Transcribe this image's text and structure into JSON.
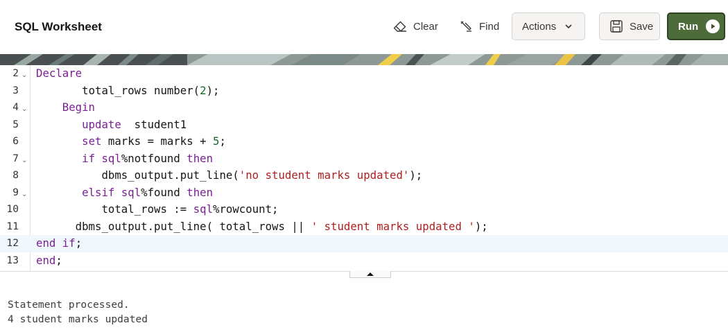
{
  "header": {
    "title": "SQL Worksheet",
    "clear_label": "Clear",
    "find_label": "Find",
    "actions_label": "Actions",
    "save_label": "Save",
    "run_label": "Run"
  },
  "editor": {
    "active_line": "12",
    "lines": [
      {
        "num": "2",
        "foldable": true
      },
      {
        "num": "3",
        "foldable": false
      },
      {
        "num": "4",
        "foldable": true
      },
      {
        "num": "5",
        "foldable": false
      },
      {
        "num": "6",
        "foldable": false
      },
      {
        "num": "7",
        "foldable": true
      },
      {
        "num": "8",
        "foldable": false
      },
      {
        "num": "9",
        "foldable": true
      },
      {
        "num": "10",
        "foldable": false
      },
      {
        "num": "11",
        "foldable": false
      },
      {
        "num": "12",
        "foldable": false
      },
      {
        "num": "13",
        "foldable": false
      }
    ],
    "code": {
      "l2_declare": "Declare",
      "l3_var": "total_rows number(",
      "l3_num": "2",
      "l3_end": ");",
      "l4_begin": "Begin",
      "l5_update": "update",
      "l5_table": "  student1",
      "l6_set": "set",
      "l6_expr": " marks = marks + ",
      "l6_num": "5",
      "l6_end": ";",
      "l7_if": "if",
      "l7_sql": "sql",
      "l7_notfound": "%notfound ",
      "l7_then": "then",
      "l8_call": "dbms_output.put_line(",
      "l8_str": "'no student marks updated'",
      "l8_end": ");",
      "l9_elsif": "elsif",
      "l9_sql": "sql",
      "l9_found": "%found ",
      "l9_then": "then",
      "l10_assign": "total_rows := ",
      "l10_sql": "sql",
      "l10_rowcount": "%rowcount;",
      "l11_call": "dbms_output.put_line( total_rows || ",
      "l11_str": "' student marks updated '",
      "l11_end": ");",
      "l12_end": "end",
      "l12_if": "if",
      "l12_semi": ";",
      "l13_end": "end",
      "l13_semi": ";"
    }
  },
  "output": {
    "line1": "Statement processed.",
    "line2": "4 student marks updated"
  },
  "colors": {
    "run_button": "#4e6c3a",
    "keyword": "#7a1f94",
    "string": "#b01e1e",
    "number": "#166a2a",
    "active_line": "#f0f7fd"
  },
  "icons": {
    "clear": "eraser-icon",
    "find": "find-icon",
    "actions": "chevron-down-icon",
    "save": "save-icon",
    "run": "play-circle-icon",
    "fold": "fold-chevron-icon",
    "splitter": "splitter-up-arrow-icon"
  }
}
